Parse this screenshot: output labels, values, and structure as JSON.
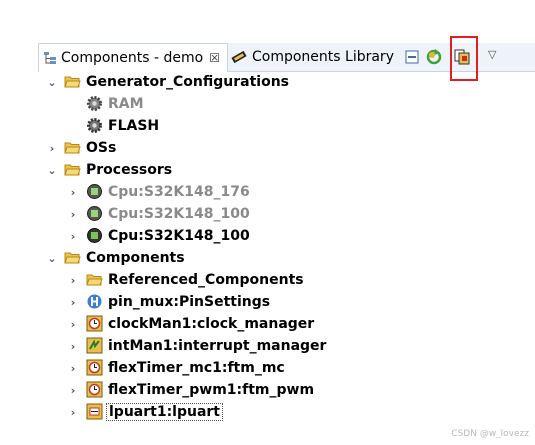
{
  "tabs": {
    "components": {
      "label": "Components - demo",
      "close": "☒"
    },
    "library": {
      "label": "Components Library"
    }
  },
  "tree": {
    "generator": {
      "label": "Generator_Configurations"
    },
    "ram": {
      "label": "RAM"
    },
    "flash": {
      "label": "FLASH"
    },
    "oss": {
      "label": "OSs"
    },
    "processors": {
      "label": "Processors"
    },
    "cpu176": {
      "label": "Cpu:S32K148_176"
    },
    "cpu100a": {
      "label": "Cpu:S32K148_100"
    },
    "cpu100b": {
      "label": "Cpu:S32K148_100"
    },
    "components": {
      "label": "Components"
    },
    "referenced": {
      "label": "Referenced_Components"
    },
    "pinmux": {
      "label": "pin_mux:PinSettings"
    },
    "clock": {
      "label": "clockMan1:clock_manager"
    },
    "interrupt": {
      "label": "intMan1:interrupt_manager"
    },
    "ftm_mc": {
      "label": "flexTimer_mc1:ftm_mc"
    },
    "ftm_pwm": {
      "label": "flexTimer_pwm1:ftm_pwm"
    },
    "lpuart": {
      "label": "lpuart1:lpuart"
    }
  },
  "watermark": "CSDN @w_lovezz",
  "colors": {
    "highlight": "#e02020",
    "folder": "#e8b530"
  }
}
